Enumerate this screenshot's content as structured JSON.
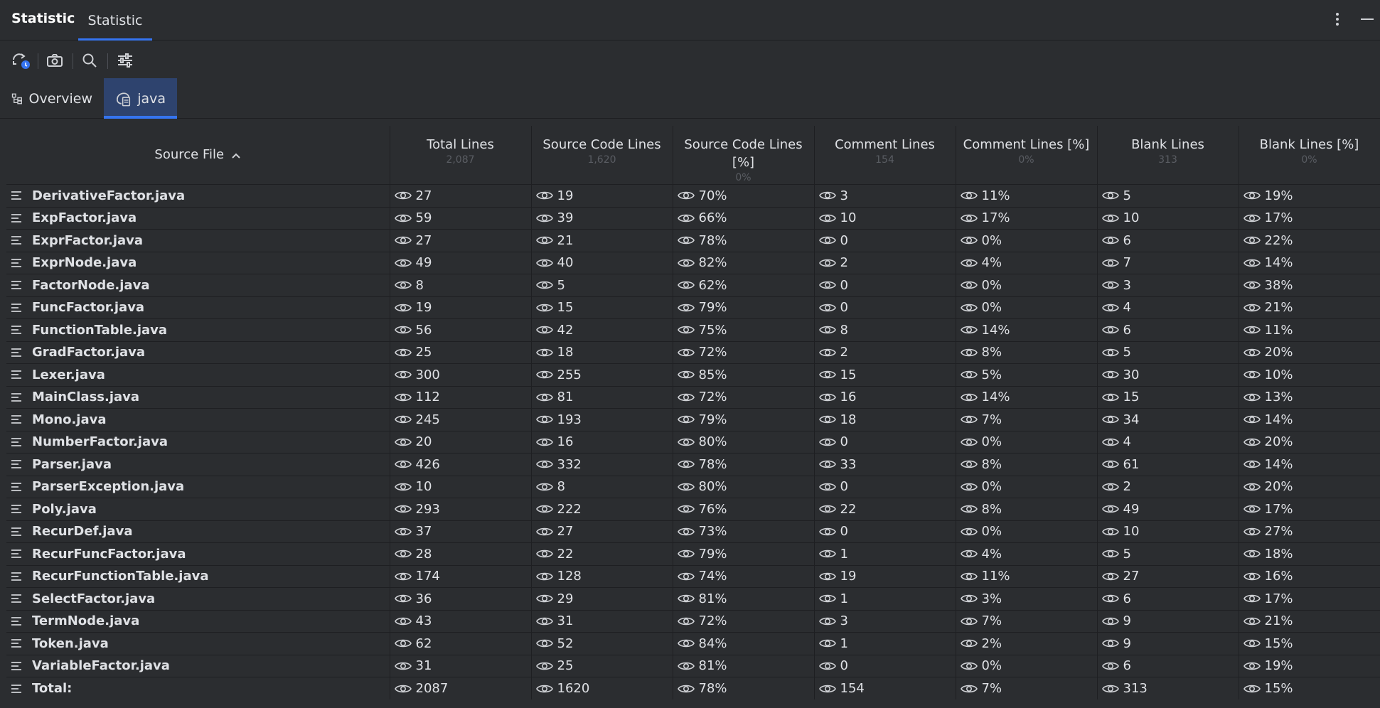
{
  "window": {
    "app_title": "Statistic",
    "tab_label": "Statistic"
  },
  "toolbar": {
    "buttons": [
      "refresh-icon",
      "camera-icon",
      "search-icon",
      "settings-sliders-icon"
    ]
  },
  "view_tabs": [
    {
      "label": "Overview",
      "icon": "tree-structure-icon",
      "active": false
    },
    {
      "label": "java",
      "icon": "java-file-icon",
      "active": true
    }
  ],
  "table": {
    "columns": [
      {
        "label": "Source File",
        "sub": "",
        "sorted": "ascending"
      },
      {
        "label": "Total Lines",
        "sub": "2,087"
      },
      {
        "label": "Source Code Lines",
        "sub": "1,620"
      },
      {
        "label": "Source Code Lines [%]",
        "sub": "0%"
      },
      {
        "label": "Comment Lines",
        "sub": "154"
      },
      {
        "label": "Comment Lines [%]",
        "sub": "0%"
      },
      {
        "label": "Blank Lines",
        "sub": "313"
      },
      {
        "label": "Blank Lines [%]",
        "sub": "0%"
      }
    ],
    "rows": [
      [
        "DerivativeFactor.java",
        "27",
        "19",
        "70%",
        "3",
        "11%",
        "5",
        "19%"
      ],
      [
        "ExpFactor.java",
        "59",
        "39",
        "66%",
        "10",
        "17%",
        "10",
        "17%"
      ],
      [
        "ExprFactor.java",
        "27",
        "21",
        "78%",
        "0",
        "0%",
        "6",
        "22%"
      ],
      [
        "ExprNode.java",
        "49",
        "40",
        "82%",
        "2",
        "4%",
        "7",
        "14%"
      ],
      [
        "FactorNode.java",
        "8",
        "5",
        "62%",
        "0",
        "0%",
        "3",
        "38%"
      ],
      [
        "FuncFactor.java",
        "19",
        "15",
        "79%",
        "0",
        "0%",
        "4",
        "21%"
      ],
      [
        "FunctionTable.java",
        "56",
        "42",
        "75%",
        "8",
        "14%",
        "6",
        "11%"
      ],
      [
        "GradFactor.java",
        "25",
        "18",
        "72%",
        "2",
        "8%",
        "5",
        "20%"
      ],
      [
        "Lexer.java",
        "300",
        "255",
        "85%",
        "15",
        "5%",
        "30",
        "10%"
      ],
      [
        "MainClass.java",
        "112",
        "81",
        "72%",
        "16",
        "14%",
        "15",
        "13%"
      ],
      [
        "Mono.java",
        "245",
        "193",
        "79%",
        "18",
        "7%",
        "34",
        "14%"
      ],
      [
        "NumberFactor.java",
        "20",
        "16",
        "80%",
        "0",
        "0%",
        "4",
        "20%"
      ],
      [
        "Parser.java",
        "426",
        "332",
        "78%",
        "33",
        "8%",
        "61",
        "14%"
      ],
      [
        "ParserException.java",
        "10",
        "8",
        "80%",
        "0",
        "0%",
        "2",
        "20%"
      ],
      [
        "Poly.java",
        "293",
        "222",
        "76%",
        "22",
        "8%",
        "49",
        "17%"
      ],
      [
        "RecurDef.java",
        "37",
        "27",
        "73%",
        "0",
        "0%",
        "10",
        "27%"
      ],
      [
        "RecurFuncFactor.java",
        "28",
        "22",
        "79%",
        "1",
        "4%",
        "5",
        "18%"
      ],
      [
        "RecurFunctionTable.java",
        "174",
        "128",
        "74%",
        "19",
        "11%",
        "27",
        "16%"
      ],
      [
        "SelectFactor.java",
        "36",
        "29",
        "81%",
        "1",
        "3%",
        "6",
        "17%"
      ],
      [
        "TermNode.java",
        "43",
        "31",
        "72%",
        "3",
        "7%",
        "9",
        "21%"
      ],
      [
        "Token.java",
        "62",
        "52",
        "84%",
        "1",
        "2%",
        "9",
        "15%"
      ],
      [
        "VariableFactor.java",
        "31",
        "25",
        "81%",
        "0",
        "0%",
        "6",
        "19%"
      ],
      [
        "Total:",
        "2087",
        "1620",
        "78%",
        "154",
        "7%",
        "313",
        "15%"
      ]
    ]
  }
}
